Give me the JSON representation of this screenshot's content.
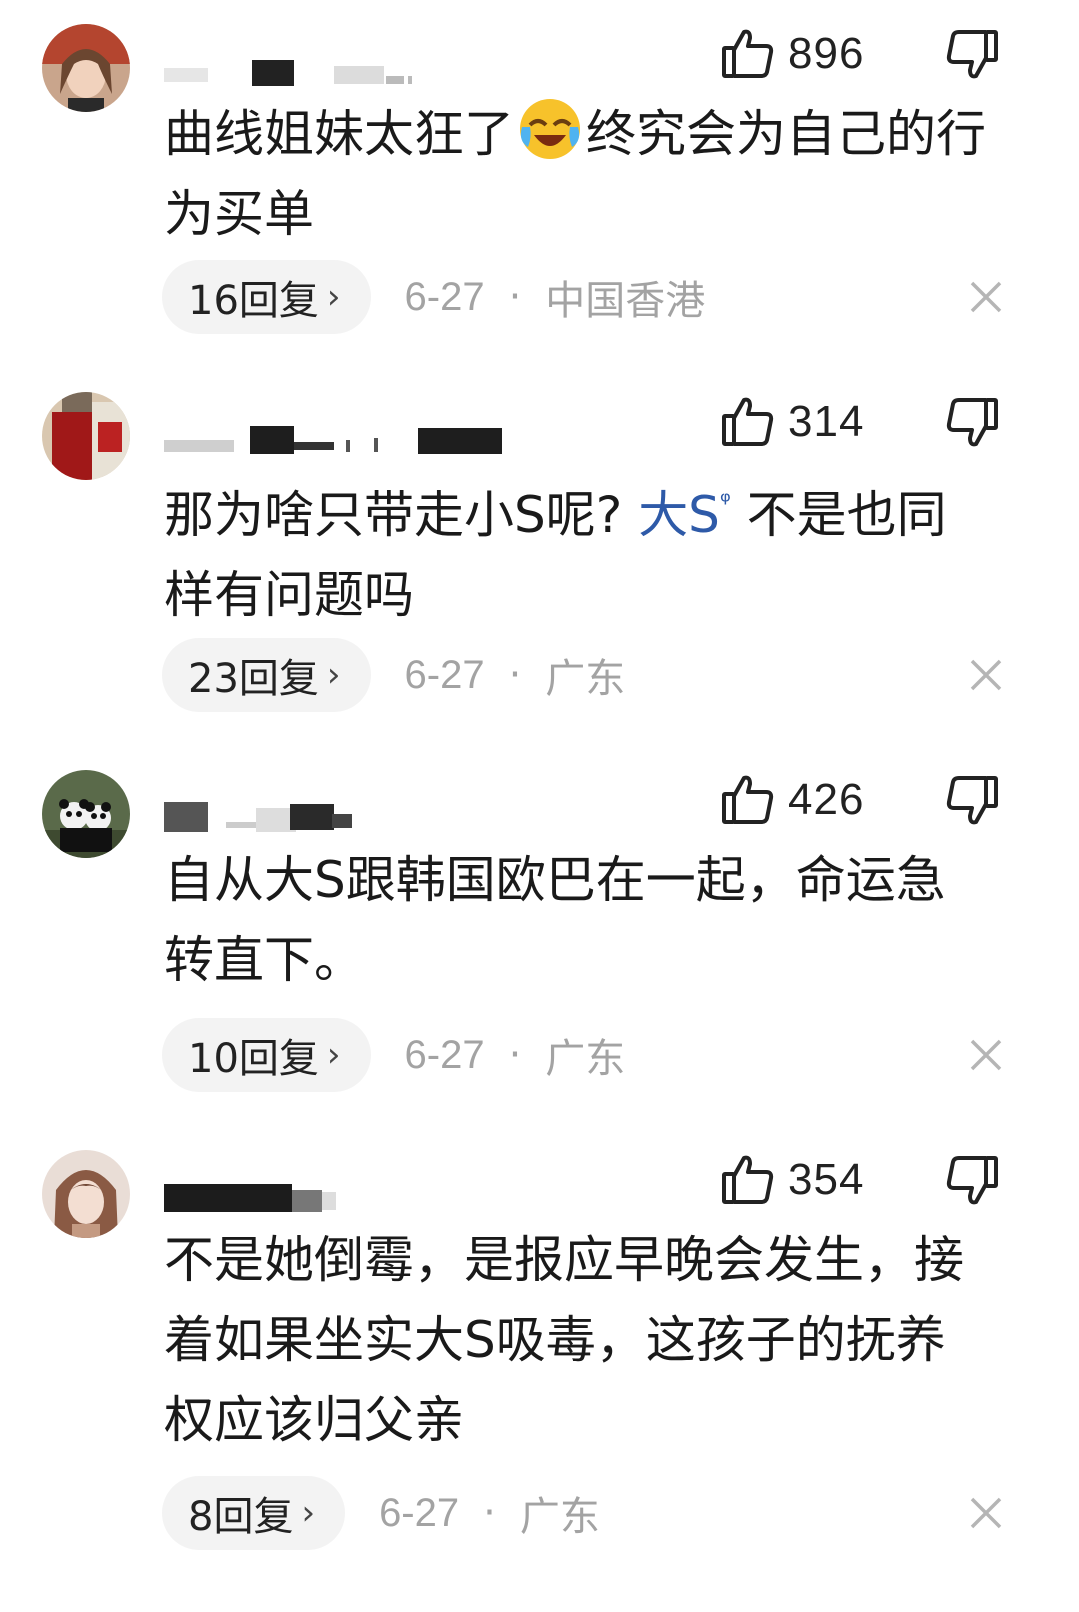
{
  "comments": [
    {
      "likes": "896",
      "text_before": "曲线姐妹太狂了",
      "text_emoji": "laughing-crying-emoji",
      "text_after": "终究会为自己的行为买单",
      "replies_label": "16回复",
      "date": "6-27",
      "separator": "·",
      "location": "中国香港"
    },
    {
      "likes": "314",
      "text_before": "那为啥只带走小S呢?",
      "mention": "大S",
      "mention_icon": "search-icon",
      "text_after": "不是也同样有问题吗",
      "replies_label": "23回复",
      "date": "6-27",
      "separator": "·",
      "location": "广东"
    },
    {
      "likes": "426",
      "text": "自从大S跟韩国欧巴在一起，命运急转直下。",
      "replies_label": "10回复",
      "date": "6-27",
      "separator": "·",
      "location": "广东"
    },
    {
      "likes": "354",
      "text": "不是她倒霉，是报应早晚会发生，接着如果坐实大S吸毒，这孩子的抚养权应该归父亲",
      "replies_label": "8回复",
      "date": "6-27",
      "separator": "·",
      "location": "广东"
    }
  ],
  "colors": {
    "mention": "#2e5aa8",
    "meta_gray": "#a3a3a3",
    "pill_bg": "#f3f3f3",
    "text": "#1a1a1a"
  }
}
